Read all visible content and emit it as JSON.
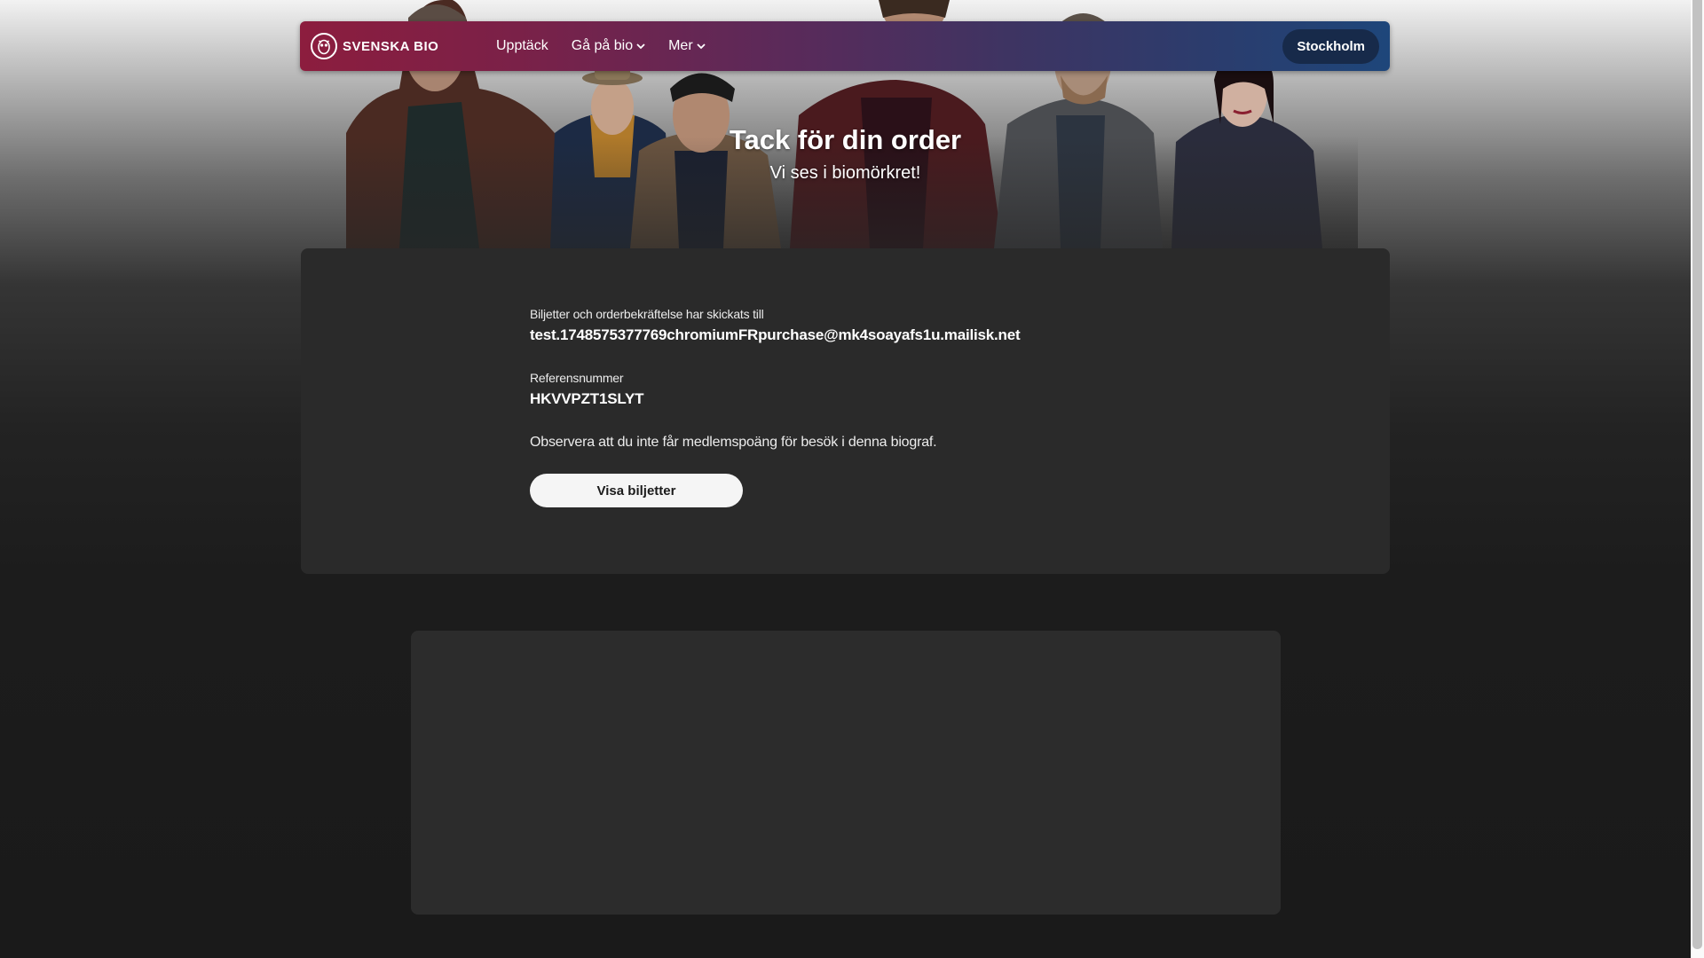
{
  "nav": {
    "logo_text": "SVENSKA BIO",
    "items": [
      {
        "label": "Upptäck",
        "has_dropdown": false
      },
      {
        "label": "Gå på bio",
        "has_dropdown": true
      },
      {
        "label": "Mer",
        "has_dropdown": true
      }
    ],
    "city_button": "Stockholm"
  },
  "hero": {
    "title": "Tack för din order",
    "subtitle": "Vi ses i biomörkret!"
  },
  "order": {
    "email_label": "Biljetter och orderbekräftelse har skickats till",
    "email_value": "test.1748575377769chromiumFRpurchase@mk4soayafs1u.mailisk.net",
    "reference_label": "Referensnummer",
    "reference_value": "HKVVPZT1SLYT",
    "notice": "Observera att du inte får medlemspoäng för besök i denna biograf.",
    "button_label": "Visa biljetter"
  },
  "colors": {
    "nav_gradient_start": "#8c1d3e",
    "nav_gradient_end": "#1e467a",
    "city_button_bg": "#172a4a",
    "card_bg": "#2a2a2a",
    "button_bg": "#f5f5f5"
  },
  "icons": {
    "logo": "owl-logo-icon",
    "dropdown": "chevron-down-icon"
  }
}
